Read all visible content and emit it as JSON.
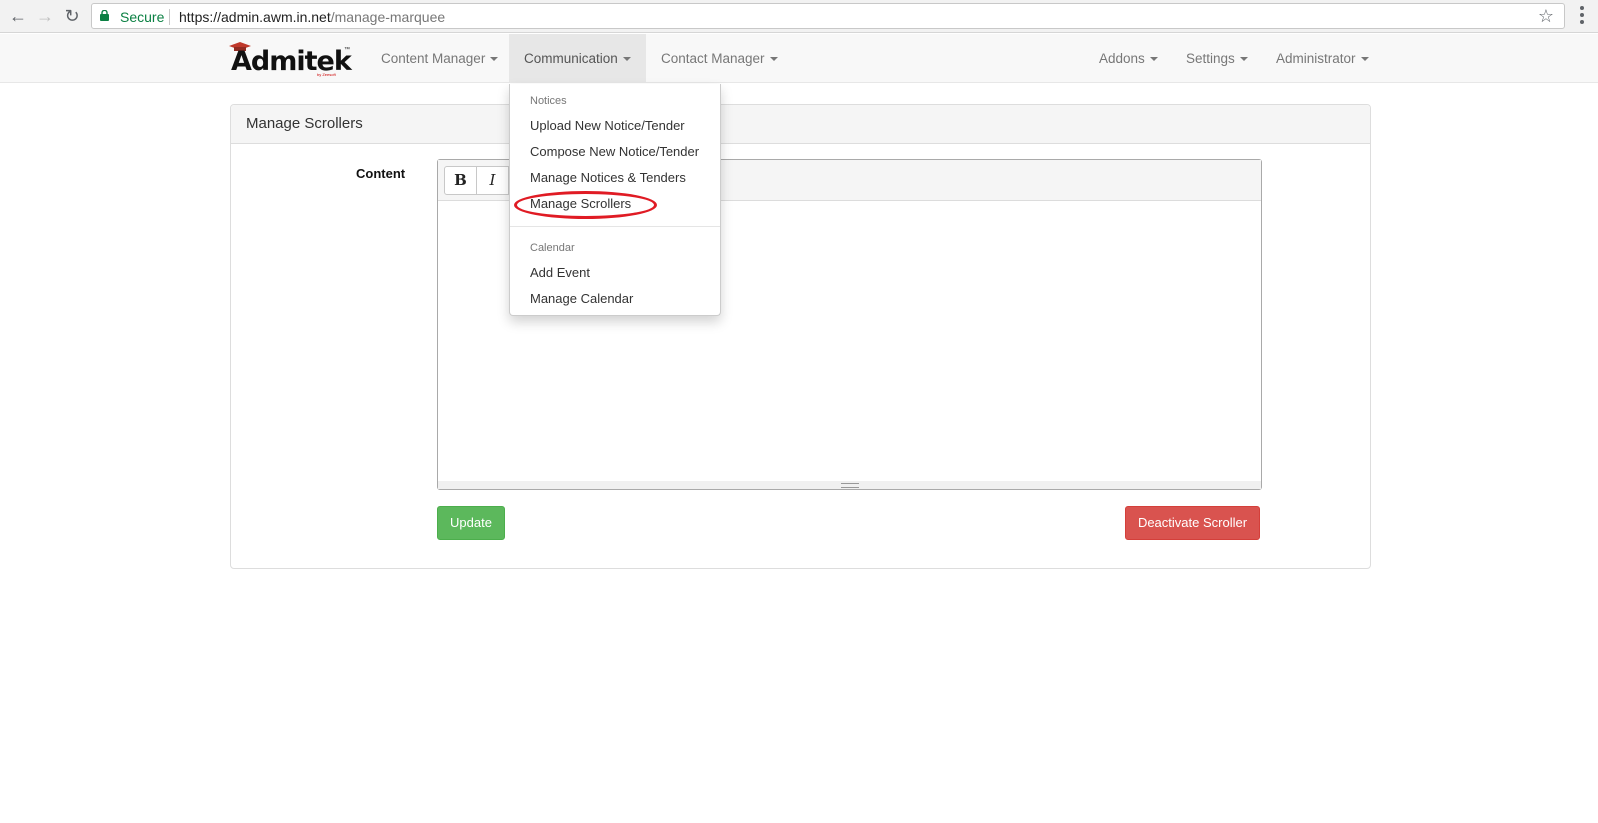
{
  "browser": {
    "security_label": "Secure",
    "url_host": "https://admin.awm.in.net",
    "url_path": "/manage-marquee"
  },
  "brand": {
    "logo_text": "Admitek",
    "trademark": "™",
    "byline": "by Zeesoft"
  },
  "nav": {
    "left": [
      {
        "label": "Content Manager"
      },
      {
        "label": "Communication"
      },
      {
        "label": "Contact Manager"
      }
    ],
    "right": [
      {
        "label": "Addons"
      },
      {
        "label": "Settings"
      },
      {
        "label": "Administrator"
      }
    ]
  },
  "dropdown": {
    "notices_header": "Notices",
    "notices_items": [
      {
        "label": "Upload New Notice/Tender"
      },
      {
        "label": "Compose New Notice/Tender"
      },
      {
        "label": "Manage Notices & Tenders"
      },
      {
        "label": "Manage Scrollers"
      }
    ],
    "calendar_header": "Calendar",
    "calendar_items": [
      {
        "label": "Add Event"
      },
      {
        "label": "Manage Calendar"
      }
    ],
    "highlight_color": "#e01b24"
  },
  "panel": {
    "title": "Manage Scrollers",
    "content_label": "Content",
    "toolbar": {
      "bold": "B",
      "italic": "I"
    },
    "update_label": "Update",
    "deactivate_label": "Deactivate Scroller"
  },
  "colors": {
    "success": "#5cb85c",
    "danger": "#d9534f",
    "secure_green": "#0b8043"
  }
}
